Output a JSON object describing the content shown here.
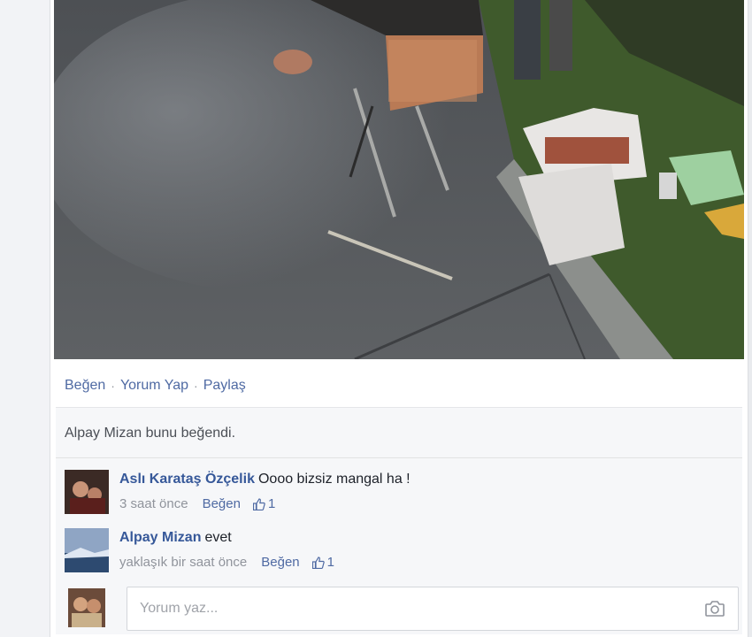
{
  "post_actions": {
    "like": "Beğen",
    "comment": "Yorum Yap",
    "share": "Paylaş",
    "separator": "·"
  },
  "likes_summary": "Alpay Mizan bunu beğendi.",
  "comments": [
    {
      "author": "Aslı Karataş Özçelik",
      "text": "Oooo bizsiz mangal ha !",
      "time": "3 saat önce",
      "like_label": "Beğen",
      "like_count": "1"
    },
    {
      "author": "Alpay Mizan",
      "text": "evet",
      "time": "yaklaşık bir saat önce",
      "like_label": "Beğen",
      "like_count": "1"
    }
  ],
  "comment_box": {
    "placeholder": "Yorum yaz..."
  },
  "icons": {
    "like_count": "thumbs-up-icon",
    "attach_photo": "camera-icon"
  },
  "colors": {
    "link": "#4f6aa3",
    "author": "#365899",
    "muted": "#90949c"
  }
}
